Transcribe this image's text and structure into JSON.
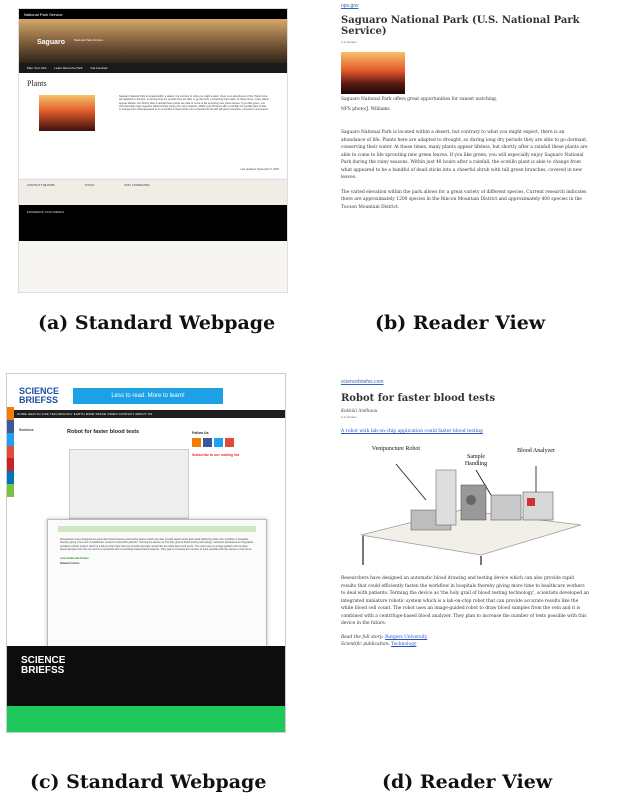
{
  "captions": {
    "a": "(a) Standard Webpage",
    "b": "(b) Reader View",
    "c": "(c) Standard Webpage",
    "d": "(d) Reader View"
  },
  "panel_a": {
    "brand": "National Park Service",
    "park_name": "Saguaro",
    "park_sub": "National Park Arizona",
    "nav": [
      "Plan Your Visit",
      "Learn About the Park",
      "Get Involved"
    ],
    "page_title": "Plants",
    "last_updated": "Last updated: September 5, 2018",
    "footer_cols": [
      "CONTACT THE PARK",
      "TOOLS",
      "STAY CONNECTED"
    ],
    "footer_tag": "EXPERIENCE YOUR AMERICA"
  },
  "panel_b": {
    "source": "nps.gov",
    "title": "Saguaro National Park (U.S. National Park Service)",
    "read_time": "1-2 minutes",
    "caption": "Saguaro National Park offers great opportunities for sunset watching.",
    "credit": "NPS photo/J. Williams",
    "para1": "Saguaro National Park is located within a desert, but contrary to what you might expect, there is an abundance of life. Plants here are adapted to drought, so during long dry periods they are able to go dormant, conserving their water. At these times, many plants appear lifeless, but shortly after a rainfall these plants are able to come to life sprouting new green leaves. If you like green, you will especially enjoy Saguaro National Park during the rainy seasons. Within just 48 hours after a rainfall, the ocotillo plant is able to change from what appeared to be a handful of dead sticks into a cheerful shrub with tall green branches, covered in new leaves.",
    "para2": "The varied elevation within the park allows for a great variety of different species. Current research indicates there are approximately 1200 species in the Rincon Mountain District and approximately 400 species in the Tucson Mountain District."
  },
  "panel_c": {
    "logo_line1": "SCIENCE",
    "logo_line2": "BRIEFSS",
    "ad": "Less to read. More to learn!",
    "nav": "HOME   HEALTH   LIFE   TECHNOLOGY   EARTH   MIND   SPACE   VIDEO   CONTACT   ABOUT US",
    "sidebar_title": "Sections",
    "article_title": "Robot for faster blood tests",
    "follow": "Follow Us",
    "subscribe": "Subscribe to our mailing list",
    "latest": "Latest Editorial Articles",
    "related": "Related Articles"
  },
  "panel_d": {
    "source": "sciencebriefss.com",
    "title": "Robot for faster blood tests",
    "author": "Kokkiiii Andhuuu",
    "read_time": "1-2 minutes",
    "link": "A robot with lab-on-chip application could faster blood testing",
    "fig_labels": [
      "Venipuncture Robot",
      "Sample Handling",
      "Blood Analyzer"
    ],
    "para": "Researchers have designed an automatic blood drawing and testing device which can also provide rapid results that could efficiently fasten the workflow in hospitals thereby giving more time to healthcare workers to deal with patients. Terming the device as 'the holy grail of blood testing technology', scientists developed an integrated miniature robotic system which is a lab-on-chip robot that can provide accurate results like the white blood cell count. The robot uses an image-guided robot to draw blood samples from the vein and it is combined with a centrifuge-based blood analyzer. They plan to increase the number of tests possible with this device in the future.",
    "read_full_label": "Read the full story:",
    "read_full_link": "Rutgers University",
    "pub_label": "Scientific publication:",
    "pub_link": "Technology"
  }
}
